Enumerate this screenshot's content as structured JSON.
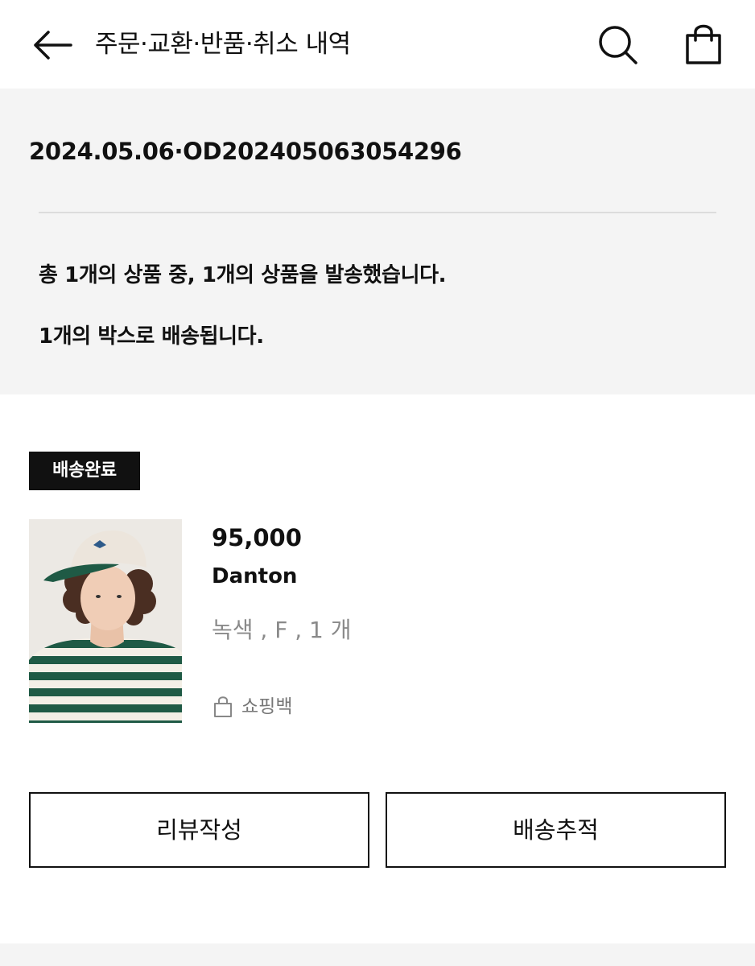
{
  "header": {
    "title": "주문·교환·반품·취소 내역",
    "icons": {
      "back": "arrow-left-icon",
      "search": "search-icon",
      "bag": "shopping-bag-icon"
    }
  },
  "summary": {
    "order_id": "2024.05.06·OD202405063054296",
    "shipped_message": "총 1개의 상품 중, 1개의 상품을 발송했습니다.",
    "box_message": "1개의 박스로 배송됩니다."
  },
  "order_item": {
    "status": "배송완료",
    "price": "95,000",
    "brand": "Danton",
    "options": "녹색 , F , 1 개",
    "bag_label": "쇼핑백",
    "bag_icon": "lock-bag-icon"
  },
  "actions": {
    "review_label": "리뷰작성",
    "track_label": "배송추적"
  },
  "colors": {
    "background": "#ffffff",
    "summary_background": "#f4f4f4",
    "primary_text": "#111111",
    "muted_text": "#8a8a8a",
    "badge_background": "#111111",
    "badge_text": "#ffffff"
  }
}
